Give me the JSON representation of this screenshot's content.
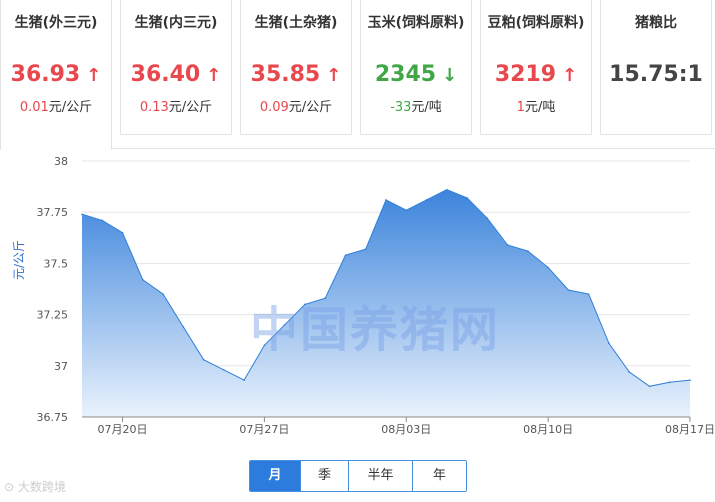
{
  "cards": [
    {
      "title": "生猪(外三元)",
      "value": "36.93",
      "arrow": "↑",
      "change": "0.01",
      "unit": "元/公斤",
      "trend": "up"
    },
    {
      "title": "生猪(内三元)",
      "value": "36.40",
      "arrow": "↑",
      "change": "0.13",
      "unit": "元/公斤",
      "trend": "up"
    },
    {
      "title": "生猪(土杂猪)",
      "value": "35.85",
      "arrow": "↑",
      "change": "0.09",
      "unit": "元/公斤",
      "trend": "up"
    },
    {
      "title": "玉米(饲料原料)",
      "value": "2345",
      "arrow": "↓",
      "change": "-33",
      "unit": "元/吨",
      "trend": "down"
    },
    {
      "title": "豆粕(饲料原料)",
      "value": "3219",
      "arrow": "↑",
      "change": "1",
      "unit": "元/吨",
      "trend": "up"
    },
    {
      "title": "猪粮比",
      "value": "15.75:1",
      "arrow": "",
      "change": "",
      "unit": "",
      "trend": "neutral"
    }
  ],
  "watermark": "中国养猪网",
  "range_buttons": [
    {
      "label": "月",
      "selected": true
    },
    {
      "label": "季",
      "selected": false
    },
    {
      "label": "半年",
      "selected": false
    },
    {
      "label": "年",
      "selected": false
    }
  ],
  "footer_text": "大数跨境",
  "chart_data": {
    "type": "area",
    "ylabel": "元/公斤",
    "ylim": [
      36.75,
      38
    ],
    "yticks": [
      36.75,
      37,
      37.25,
      37.5,
      37.75,
      38
    ],
    "xtick_labels": [
      "07月20日",
      "07月27日",
      "08月03日",
      "08月10日",
      "08月17日"
    ],
    "x": [
      "07月18日",
      "07月19日",
      "07月20日",
      "07月21日",
      "07月22日",
      "07月23日",
      "07月24日",
      "07月25日",
      "07月26日",
      "07月27日",
      "07月28日",
      "07月29日",
      "07月30日",
      "07月31日",
      "08月01日",
      "08月02日",
      "08月03日",
      "08月04日",
      "08月05日",
      "08月06日",
      "08月07日",
      "08月08日",
      "08月09日",
      "08月10日",
      "08月11日",
      "08月12日",
      "08月13日",
      "08月14日",
      "08月15日",
      "08月16日",
      "08月17日"
    ],
    "values": [
      37.74,
      37.71,
      37.65,
      37.42,
      37.35,
      37.19,
      37.03,
      36.98,
      36.93,
      37.1,
      37.2,
      37.3,
      37.33,
      37.54,
      37.57,
      37.81,
      37.76,
      37.81,
      37.86,
      37.82,
      37.72,
      37.59,
      37.56,
      37.48,
      37.37,
      37.35,
      37.11,
      36.97,
      36.9,
      36.92,
      36.93
    ],
    "grid": true,
    "colors": {
      "line": "#2f7fd8",
      "fill_top": "#3c84dc",
      "fill_bottom": "#e9f2fc"
    }
  }
}
